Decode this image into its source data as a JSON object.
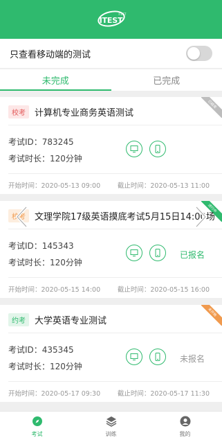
{
  "header": {
    "logo_text": "ITEST",
    "logo_small": "ITEST"
  },
  "filter": {
    "label": "只查看移动端的测试",
    "enabled": false
  },
  "tabs": [
    {
      "label": "未完成",
      "active": true
    },
    {
      "label": "已完成",
      "active": false
    }
  ],
  "exams": [
    {
      "tag": "校考",
      "tag_color": "#e35a5a",
      "title": "计算机专业商务英语测试",
      "id_text": "考试ID：783245",
      "duration_text": "考试时长：120分钟",
      "status": "",
      "start": "开始时间：2020-05-13 09:00",
      "end": "截止时间：2020-05-13 11:00",
      "ribbon": "已结束",
      "ribbon_color": "#bdbdbd",
      "icons": [
        "desktop-icon",
        "mobile-icon"
      ]
    },
    {
      "tag": "校考",
      "tag_color": "#f09a4e",
      "title": "文理学院17级英语摸底考试5月15日14:00场",
      "id_text": "考试ID：145343",
      "duration_text": "考试时长：120分钟",
      "status": "已报名",
      "start": "开始时间：2020-05-15 14:00",
      "end": "截止时间：2020-05-15 16:00",
      "ribbon": "进行中",
      "ribbon_color": "#2fba6e",
      "icons": [
        "desktop-icon",
        "mobile-icon"
      ]
    },
    {
      "tag": "约考",
      "tag_color": "#2fba6e",
      "title": "大学英语专业测试",
      "id_text": "考试ID：435345",
      "duration_text": "考试时长：120分钟",
      "status": "未报名",
      "start": "开始时间：2020-05-17 09:30",
      "end": "截止时间：2020-05-17 11:30",
      "ribbon": "未开始",
      "ribbon_color": "#f09a4e",
      "icons": [
        "desktop-icon",
        "mobile-icon"
      ]
    }
  ],
  "tabbar": [
    {
      "label": "考试",
      "icon": "compass-icon",
      "active": true
    },
    {
      "label": "训练",
      "icon": "layers-icon",
      "active": false
    },
    {
      "label": "我的",
      "icon": "user-icon",
      "active": false
    }
  ],
  "colors": {
    "primary": "#2fba6e",
    "background": "#efefef"
  }
}
